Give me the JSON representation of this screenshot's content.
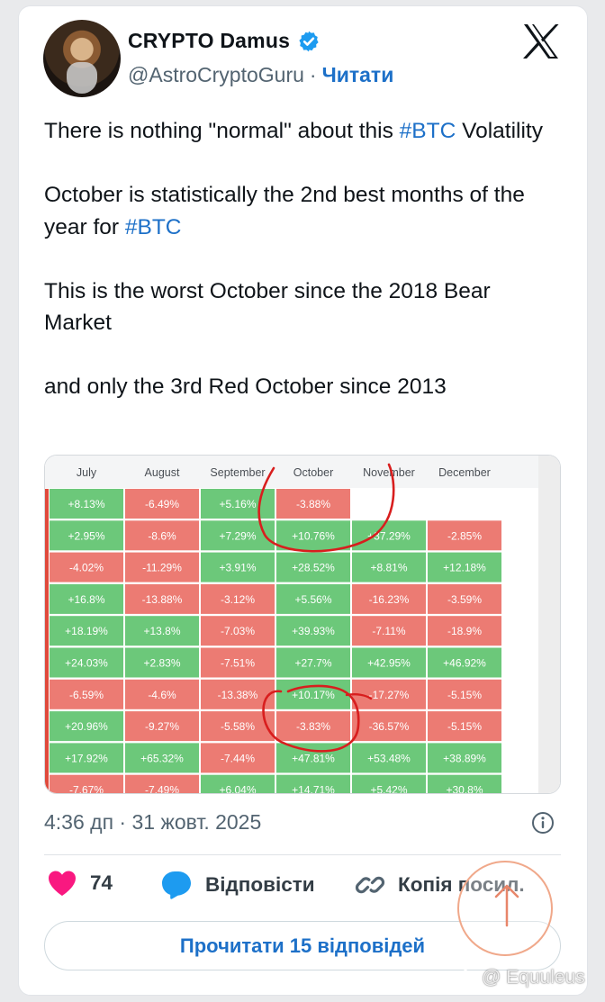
{
  "author": {
    "display_name": "CRYPTO Damus",
    "handle": "@AstroCryptoGuru",
    "separator": "·",
    "follow_label": "Читати"
  },
  "tweet": {
    "paragraphs": [
      {
        "before": "There is nothing \"normal\" about this ",
        "hashtag": "#BTC",
        "after": " Volatility"
      },
      {
        "before": "October is statistically the 2nd best months of the year for ",
        "hashtag": "#BTC",
        "after": ""
      },
      {
        "before": "This is the worst October since the 2018 Bear Market",
        "hashtag": "",
        "after": ""
      },
      {
        "before": "and only the 3rd Red October since 2013",
        "hashtag": "",
        "after": ""
      }
    ],
    "timestamp": "4:36 дп · 31 жовт. 2025"
  },
  "actions": {
    "likes_count": "74",
    "reply_label": "Відповісти",
    "copy_link_label": "Копія посил.",
    "read_replies_label": "Прочитати 15 відповідей"
  },
  "watermark": "@ Equuleus",
  "colors": {
    "green_cell": "#6cc87a",
    "red_cell": "#ec7b73",
    "link": "#1d70c8",
    "like": "#f91880",
    "reply": "#1d9bf0",
    "annotation": "#d81e1e"
  },
  "media_table": {
    "headers": [
      "July",
      "August",
      "September",
      "October",
      "November",
      "December"
    ],
    "rows": [
      [
        "+8.13%",
        "-6.49%",
        "+5.16%",
        "-3.88%",
        "",
        ""
      ],
      [
        "+2.95%",
        "-8.6%",
        "+7.29%",
        "+10.76%",
        "+37.29%",
        "-2.85%"
      ],
      [
        "-4.02%",
        "-11.29%",
        "+3.91%",
        "+28.52%",
        "+8.81%",
        "+12.18%"
      ],
      [
        "+16.8%",
        "-13.88%",
        "-3.12%",
        "+5.56%",
        "-16.23%",
        "-3.59%"
      ],
      [
        "+18.19%",
        "+13.8%",
        "-7.03%",
        "+39.93%",
        "-7.11%",
        "-18.9%"
      ],
      [
        "+24.03%",
        "+2.83%",
        "-7.51%",
        "+27.7%",
        "+42.95%",
        "+46.92%"
      ],
      [
        "-6.59%",
        "-4.6%",
        "-13.38%",
        "+10.17%",
        "-17.27%",
        "-5.15%"
      ],
      [
        "+20.96%",
        "-9.27%",
        "-5.58%",
        "-3.83%",
        "-36.57%",
        "-5.15%"
      ],
      [
        "+17.92%",
        "+65.32%",
        "-7.44%",
        "+47.81%",
        "+53.48%",
        "+38.89%"
      ],
      [
        "-7.67%",
        "-7.49%",
        "+6.04%",
        "+14.71%",
        "+5.42%",
        "+30.8%"
      ]
    ]
  }
}
